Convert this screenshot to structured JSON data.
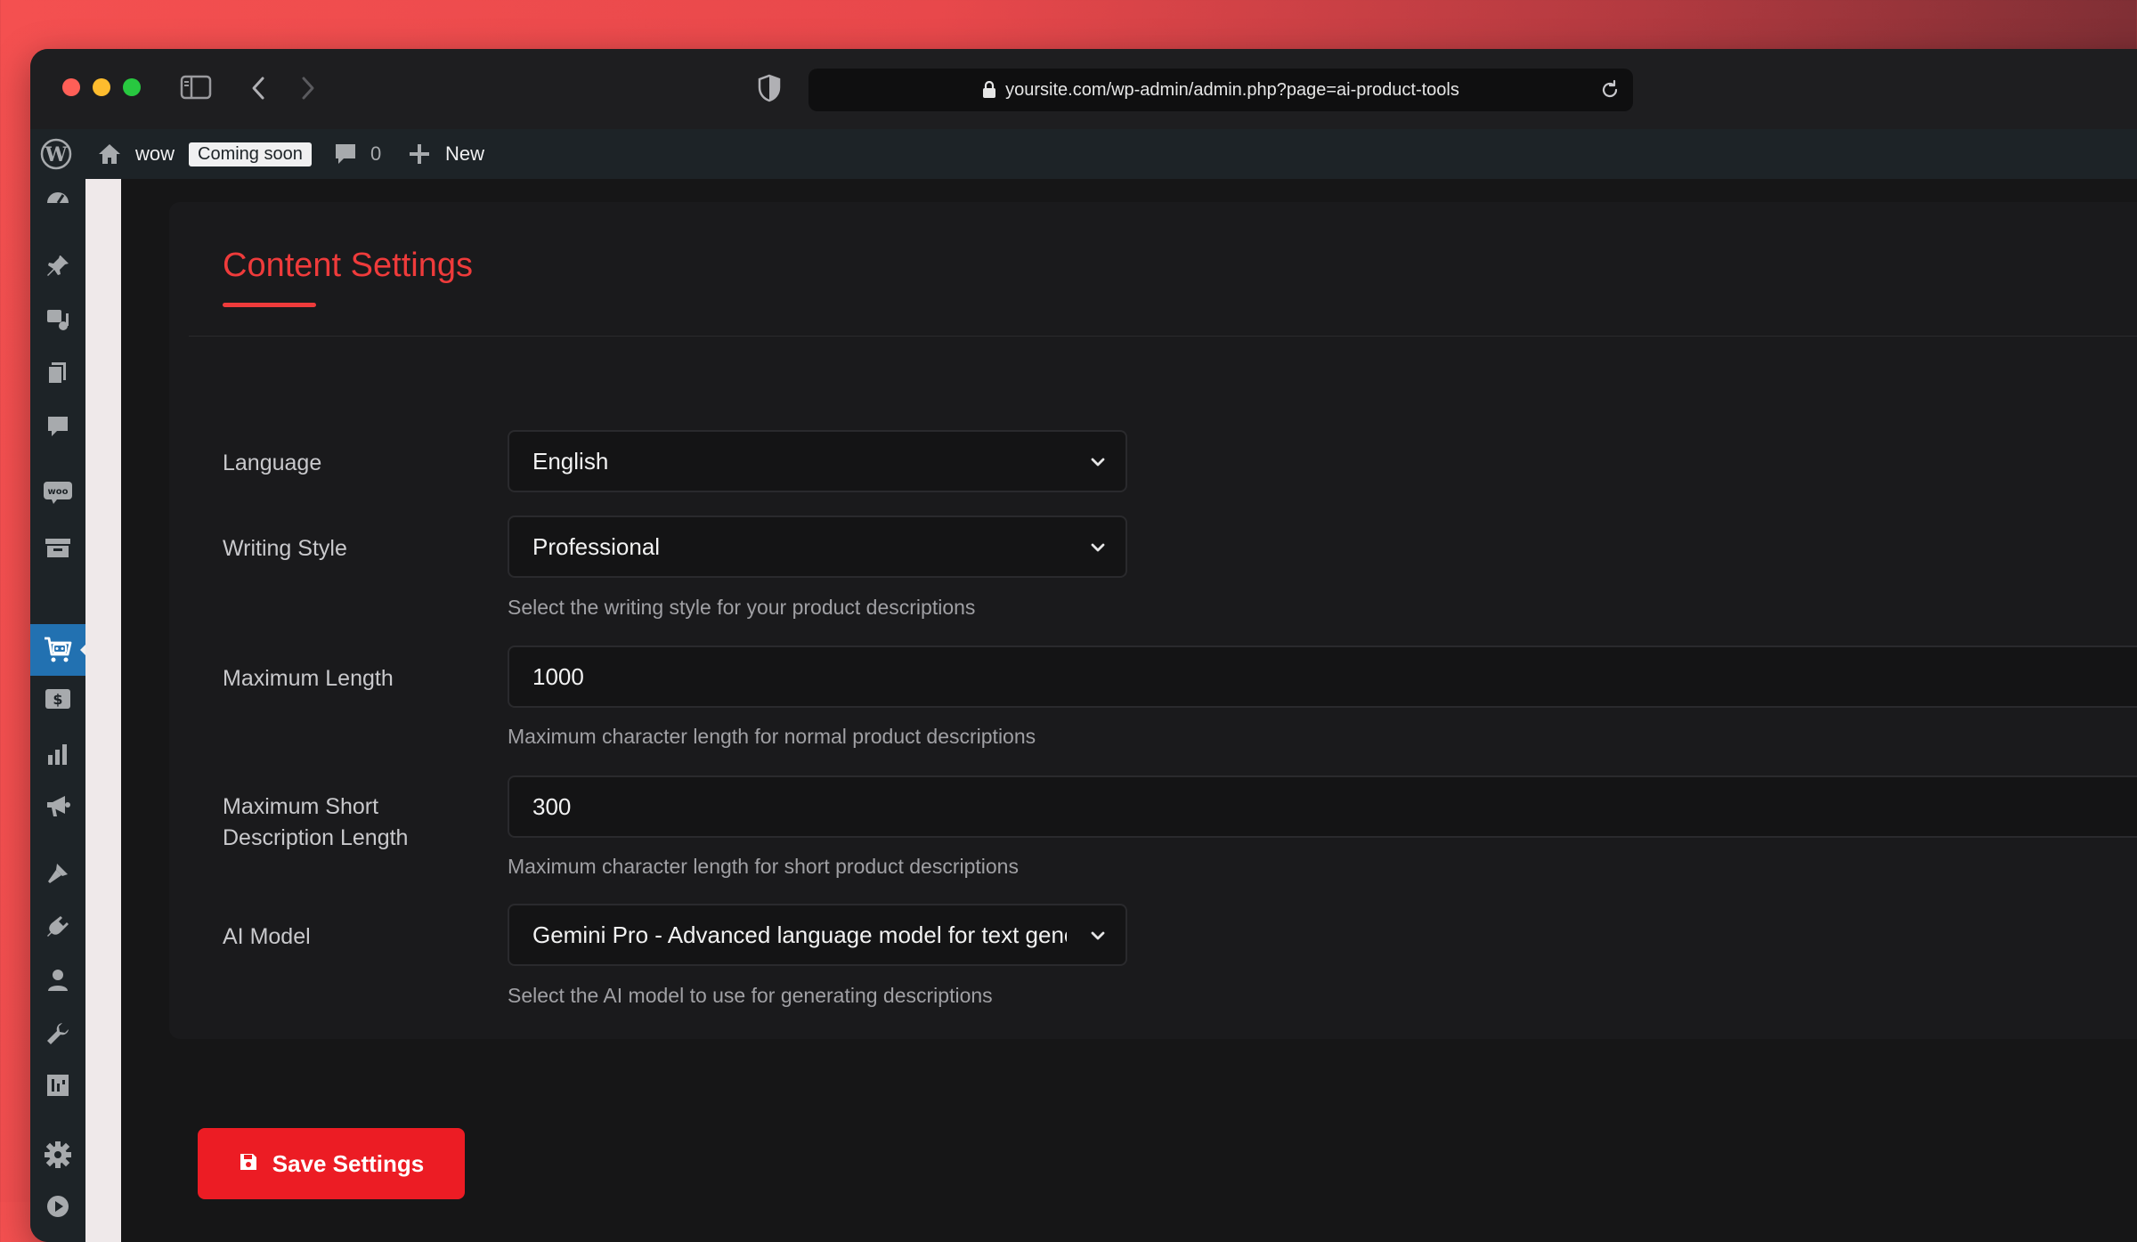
{
  "browser": {
    "url": "yoursite.com/wp-admin/admin.php?page=ai-product-tools"
  },
  "adminbar": {
    "site_name": "wow",
    "coming_soon": "Coming soon",
    "comments_count": "0",
    "new_label": "New"
  },
  "settings": {
    "title": "Content Settings",
    "fields": {
      "language": {
        "label": "Language",
        "value": "English"
      },
      "writing_style": {
        "label": "Writing Style",
        "value": "Professional",
        "help": "Select the writing style for your product descriptions"
      },
      "max_length": {
        "label": "Maximum Length",
        "value": "1000",
        "help": "Maximum character length for normal product descriptions"
      },
      "max_short_length": {
        "label_line1": "Maximum Short",
        "label_line2": "Description Length",
        "value": "300",
        "help": "Maximum character length for short product descriptions"
      },
      "ai_model": {
        "label": "AI Model",
        "value": "Gemini Pro - Advanced language model for text genera",
        "help": "Select the AI model to use for generating descriptions"
      }
    },
    "save_label": "Save Settings"
  },
  "colors": {
    "accent": "#ef3b3b",
    "button": "#ec1c24",
    "wp_active": "#2271b1"
  },
  "sidebar_icons": [
    "dashboard-icon",
    "pin-icon",
    "media-icon",
    "pages-icon",
    "comments-icon",
    "woo-icon",
    "products-icon",
    "ai-tools-icon",
    "payments-icon",
    "analytics-icon",
    "marketing-icon",
    "appearance-icon",
    "plugins-icon",
    "users-icon",
    "tools-icon",
    "import-icon",
    "settings-icon",
    "play-icon"
  ]
}
